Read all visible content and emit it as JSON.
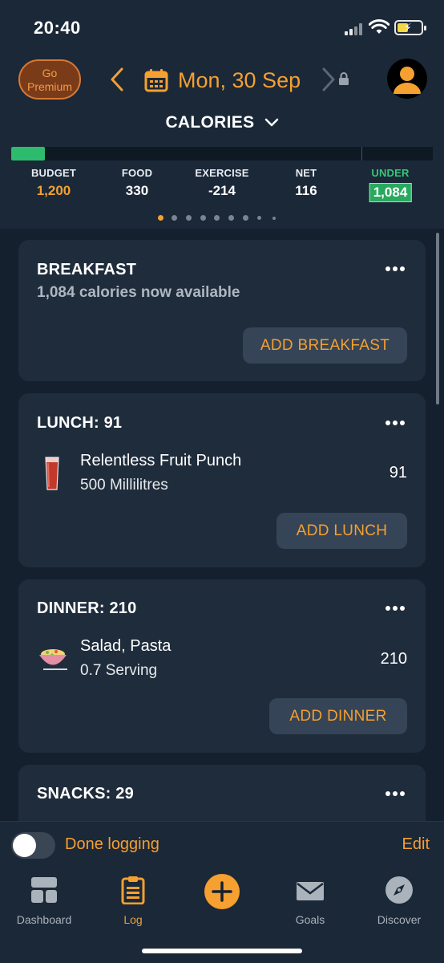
{
  "status": {
    "time": "20:40"
  },
  "header": {
    "premium_label": "Go Premium",
    "premium_line1": "Go",
    "premium_line2": "Premium",
    "date": "Mon, 30 Sep",
    "section_title": "CALORIES"
  },
  "progress": {
    "fraction": 0.08
  },
  "stats": [
    {
      "label": "BUDGET",
      "value": "1,200"
    },
    {
      "label": "FOOD",
      "value": "330"
    },
    {
      "label": "EXERCISE",
      "value": "-214"
    },
    {
      "label": "NET",
      "value": "116"
    },
    {
      "label": "UNDER",
      "value": "1,084"
    }
  ],
  "pager": {
    "count": 9,
    "active": 0
  },
  "meals": {
    "breakfast": {
      "title": "BREAKFAST",
      "subtitle": "1,084 calories now available",
      "button": "ADD BREAKFAST"
    },
    "lunch": {
      "title": "LUNCH: 91",
      "item": {
        "name": "Relentless Fruit Punch",
        "qty": "500 Millilitres",
        "cal": "91"
      },
      "button": "ADD LUNCH"
    },
    "dinner": {
      "title": "DINNER: 210",
      "item": {
        "name": "Salad, Pasta",
        "qty": "0.7 Serving",
        "cal": "210"
      },
      "button": "ADD DINNER"
    },
    "snacks": {
      "title": "SNACKS: 29"
    }
  },
  "footer": {
    "done_label": "Done logging",
    "edit_label": "Edit"
  },
  "tabs": [
    {
      "label": "Dashboard",
      "icon": "dashboard-icon"
    },
    {
      "label": "Log",
      "icon": "clipboard-icon"
    },
    {
      "label": "",
      "icon": "plus-icon"
    },
    {
      "label": "Goals",
      "icon": "envelope-icon"
    },
    {
      "label": "Discover",
      "icon": "compass-icon"
    }
  ],
  "colors": {
    "accent": "#f5a030",
    "green": "#2dbb6e",
    "card": "#1f2c3b",
    "background": "#14202e"
  }
}
